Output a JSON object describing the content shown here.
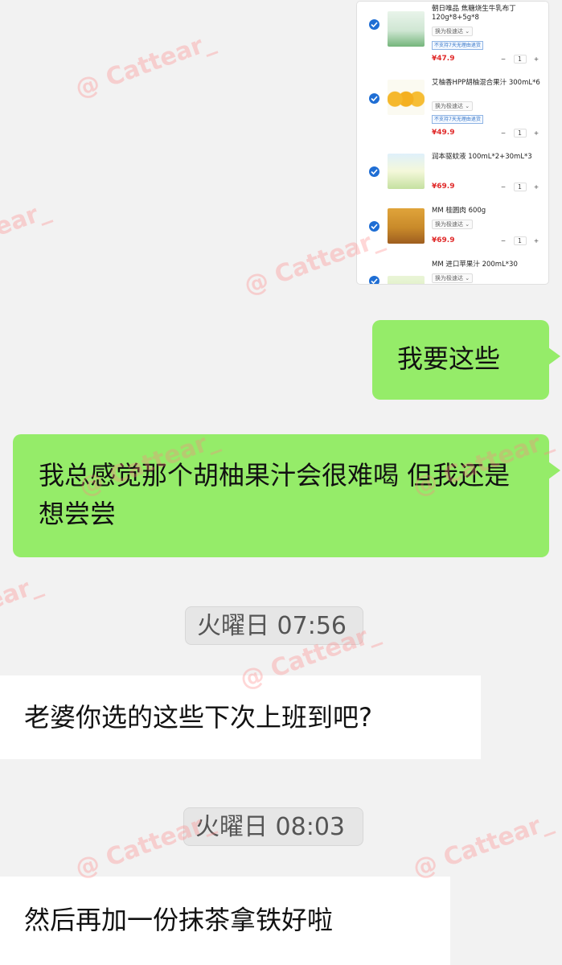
{
  "cart": {
    "items": [
      {
        "title": "朝日唯品 焦糖烧生牛乳布丁 120g*8+5g*8",
        "shipping": "换为极速达 ⌄",
        "tag": "不支持7天无理由退货",
        "price": "¥47.9",
        "qty": [
          "−",
          "1",
          "+"
        ]
      },
      {
        "title": "艾柚香HPP胡柚混合果汁 300mL*6",
        "shipping": "换为极速达 ⌄",
        "tag": "不支持7天无理由退货",
        "price": "¥49.9",
        "qty": [
          "−",
          "1",
          "+"
        ]
      },
      {
        "title": "润本驱蚊液 100mL*2+30mL*3",
        "price": "¥69.9",
        "qty": [
          "−",
          "1",
          "+"
        ]
      },
      {
        "title": "MM 桂圆肉 600g",
        "shipping": "换为极速达 ⌄",
        "price": "¥69.9",
        "qty": [
          "−",
          "1",
          "+"
        ]
      },
      {
        "title": "MM 进口苹果汁 200mL*30",
        "shipping": "换为极速达 ⌄"
      }
    ]
  },
  "messages": {
    "m1": "我要这些",
    "m2": "我总感觉那个胡柚果汁会很难喝 但我还是想尝尝",
    "m3": "老婆你选的这些下次上班到吧?",
    "m4": "然后再加一份抹茶拿铁好啦"
  },
  "timestamps": {
    "t1": "火曜日 07:56",
    "t2": "火曜日 08:03"
  },
  "watermark": "@ Cattear_",
  "colors": {
    "sent_bubble": "#95ec69",
    "received_bubble": "#ffffff",
    "background": "#f2f2f2",
    "price": "#e02a2a",
    "checkbox": "#1f6ed4"
  }
}
